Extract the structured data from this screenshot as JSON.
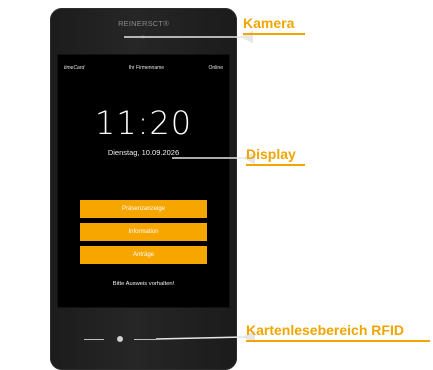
{
  "device": {
    "brand": "REINERSCT®"
  },
  "screen": {
    "app_name": "timeCard",
    "company": "Ihr Firmenname",
    "status": "Online",
    "time": "11:20",
    "date": "Dienstag, 10.09.2026",
    "buttons": [
      {
        "label": "Präsenzanzeige"
      },
      {
        "label": "Information"
      },
      {
        "label": "Anträge"
      }
    ],
    "hint": "Bitte Ausweis vorhalten!"
  },
  "callouts": {
    "camera": "Kamera",
    "display": "Display",
    "rfid": "Kartenlesebereich RFID"
  },
  "colors": {
    "accent": "#f7a600",
    "label": "#f0a500",
    "screen_bg": "#000000",
    "device_bg": "#222223"
  }
}
